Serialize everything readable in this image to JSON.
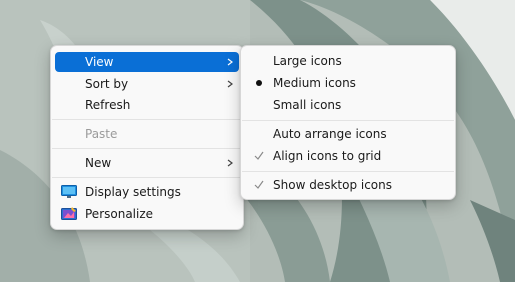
{
  "context_menu": {
    "items": {
      "view": "View",
      "sort_by": "Sort by",
      "refresh": "Refresh",
      "paste": "Paste",
      "new": "New",
      "display_settings": "Display settings",
      "personalize": "Personalize"
    }
  },
  "view_submenu": {
    "large_icons": "Large icons",
    "medium_icons": "Medium icons",
    "small_icons": "Small icons",
    "auto_arrange": "Auto arrange icons",
    "align_to_grid": "Align icons to grid",
    "show_desktop_icons": "Show desktop icons",
    "selected_size": "Medium icons",
    "checked_options": [
      "Align icons to grid",
      "Show desktop icons"
    ]
  },
  "colors": {
    "highlight": "#0a6fd6",
    "menu_background": "#f9f9f9",
    "disabled_text": "#9b9b9b"
  }
}
